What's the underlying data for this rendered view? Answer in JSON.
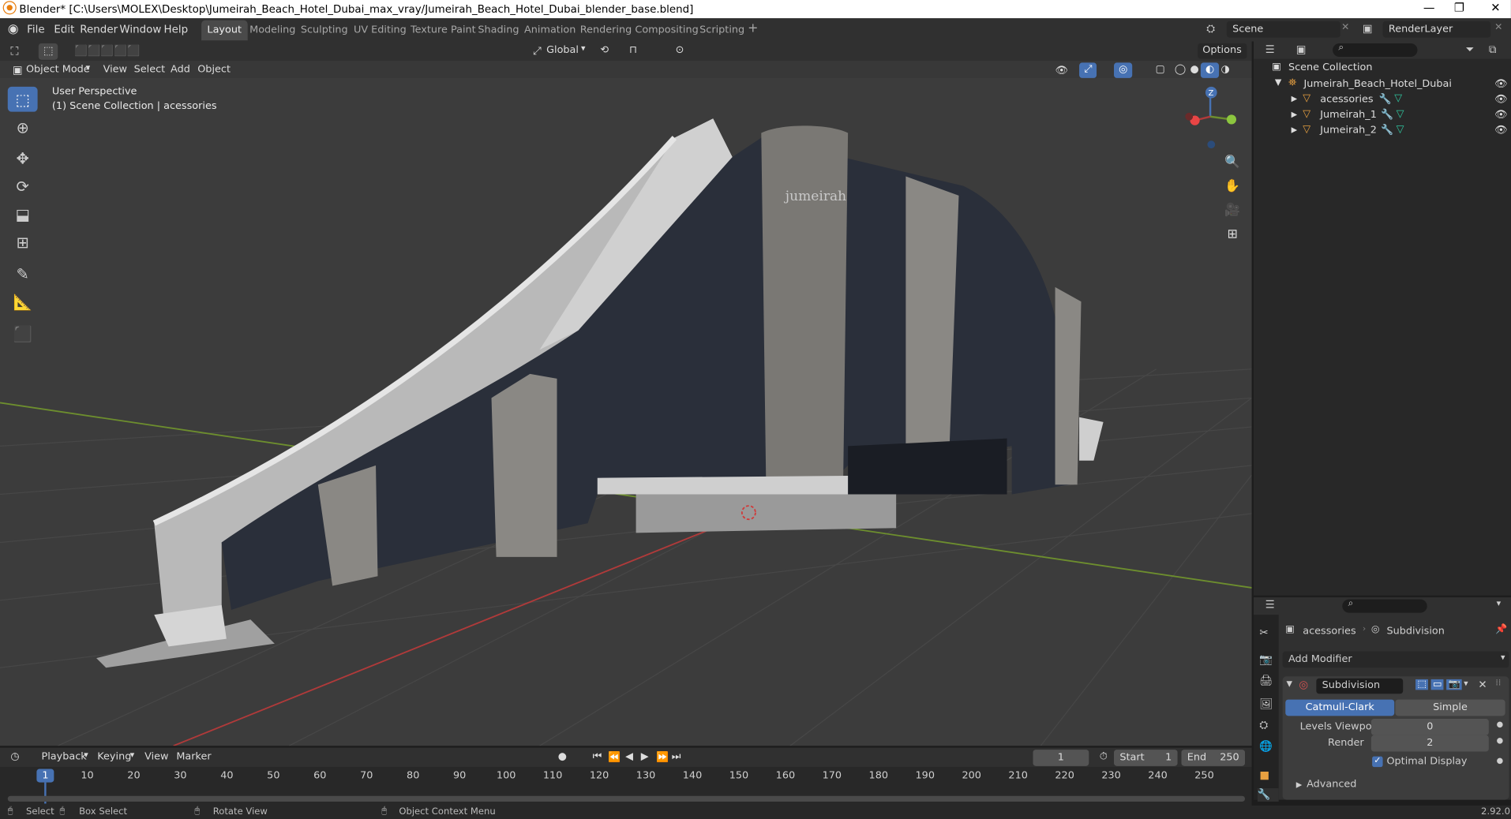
{
  "window": {
    "title": "Blender* [C:\\Users\\MOLEX\\Desktop\\Jumeirah_Beach_Hotel_Dubai_max_vray/Jumeirah_Beach_Hotel_Dubai_blender_base.blend]",
    "minimize": "—",
    "maximize": "❐",
    "close": "✕"
  },
  "topbar": {
    "menus": [
      "File",
      "Edit",
      "Render",
      "Window",
      "Help"
    ],
    "workspaces": [
      "Layout",
      "Modeling",
      "Sculpting",
      "UV Editing",
      "Texture Paint",
      "Shading",
      "Animation",
      "Rendering",
      "Compositing",
      "Scripting"
    ],
    "active_workspace": "Layout",
    "add_workspace": "+",
    "scene": "Scene",
    "render_layer": "RenderLayer"
  },
  "viewport": {
    "mode": "Object Mode",
    "menus": [
      "View",
      "Select",
      "Add",
      "Object"
    ],
    "orientation": "Global",
    "options": "Options",
    "overlay_line1": "User Perspective",
    "overlay_line2": "(1) Scene Collection | acessories",
    "gizmo_z": "Z",
    "building_logo": "jumeirah",
    "colors": {
      "background": "#3c3c3c",
      "x_axis": "#b03a3a",
      "y_axis": "#6d8e2e",
      "active_tool": "#4772b3"
    }
  },
  "outliner": {
    "root": "Scene Collection",
    "collection": "Jumeirah_Beach_Hotel_Dubai",
    "objects": [
      "acessories",
      "Jumeirah_1",
      "Jumeirah_2"
    ]
  },
  "properties": {
    "breadcrumb_object": "acessories",
    "breadcrumb_modifier": "Subdivision",
    "add_modifier": "Add Modifier",
    "modifier_name": "Subdivision",
    "type_catmull": "Catmull-Clark",
    "type_simple": "Simple",
    "levels_viewport_label": "Levels Viewport",
    "levels_viewport_value": "0",
    "render_label": "Render",
    "render_value": "2",
    "optimal_display": "Optimal Display",
    "optimal_display_checked": true,
    "advanced": "Advanced"
  },
  "timeline": {
    "menus": [
      "Playback",
      "Keying",
      "View",
      "Marker"
    ],
    "current_frame": "1",
    "start_label": "Start",
    "start_value": "1",
    "end_label": "End",
    "end_value": "250",
    "ticks": [
      "1",
      "10",
      "20",
      "30",
      "40",
      "50",
      "60",
      "70",
      "80",
      "90",
      "100",
      "110",
      "120",
      "130",
      "140",
      "150",
      "160",
      "170",
      "180",
      "190",
      "200",
      "210",
      "220",
      "230",
      "240",
      "250"
    ]
  },
  "statusbar": {
    "select": "Select",
    "box_select": "Box Select",
    "rotate_view": "Rotate View",
    "context_menu": "Object Context Menu",
    "version": "2.92.0"
  }
}
